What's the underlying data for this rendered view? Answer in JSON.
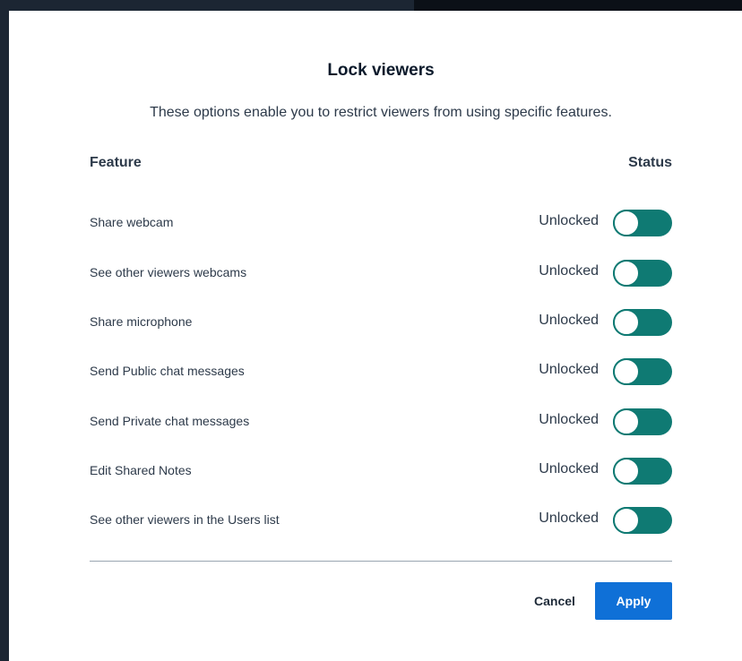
{
  "dialog": {
    "title": "Lock viewers",
    "description": "These options enable you to restrict viewers from using specific features."
  },
  "table": {
    "feature_header": "Feature",
    "status_header": "Status",
    "rows": [
      {
        "label": "Share webcam",
        "status": "Unlocked",
        "locked": false
      },
      {
        "label": "See other viewers webcams",
        "status": "Unlocked",
        "locked": false
      },
      {
        "label": "Share microphone",
        "status": "Unlocked",
        "locked": false
      },
      {
        "label": "Send Public chat messages",
        "status": "Unlocked",
        "locked": false
      },
      {
        "label": "Send Private chat messages",
        "status": "Unlocked",
        "locked": false
      },
      {
        "label": "Edit Shared Notes",
        "status": "Unlocked",
        "locked": false
      },
      {
        "label": "See other viewers in the Users list",
        "status": "Unlocked",
        "locked": false
      }
    ]
  },
  "actions": {
    "cancel_label": "Cancel",
    "apply_label": "Apply"
  },
  "colors": {
    "toggle_track": "#0f7a73",
    "apply_button": "#0f70d7",
    "backdrop": "#1c2633"
  }
}
